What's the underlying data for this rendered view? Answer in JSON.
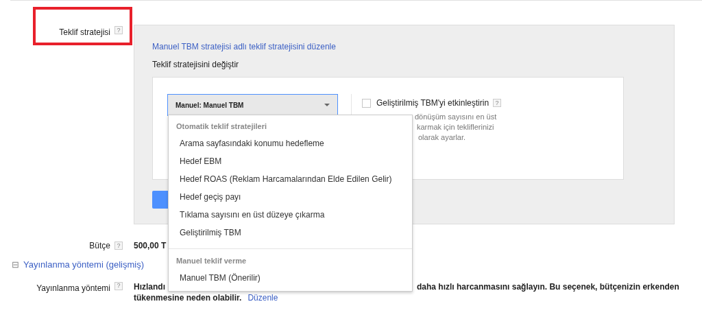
{
  "bid_strategy": {
    "label": "Teklif stratejisi",
    "help": "?",
    "highlighted": true,
    "edit_link": "Manuel TBM stratejisi adlı teklif stratejisini düzenle",
    "change_heading": "Teklif stratejisini değiştir",
    "dropdown": {
      "value": "Manuel: Manuel TBM",
      "expanded": true
    },
    "enhanced_cpc": {
      "label": "Geliştirilmiş TBM'yi etkinleştirin",
      "help": "?",
      "checked": false,
      "description_lines": [
        "dönüşüm sayısını en üst",
        "karmak için tekliflerinizi",
        "olarak ayarlar."
      ]
    }
  },
  "menu": {
    "groups": [
      {
        "header": "Otomatik teklif stratejileri",
        "items": [
          "Arama sayfasındaki konumu hedefleme",
          "Hedef EBM",
          "Hedef ROAS (Reklam Harcamalarından Elde Edilen Gelir)",
          "Hedef geçiş payı",
          "Tıklama sayısını en üst düzeye çıkarma",
          "Geliştirilmiş TBM"
        ]
      },
      {
        "header": "Manuel teklif verme",
        "items": [
          "Manuel TBM (Önerilir)"
        ]
      }
    ]
  },
  "budget": {
    "label": "Bütçe",
    "help": "?",
    "value": "500,00 T"
  },
  "delivery_section": {
    "toggle": "⊟",
    "title": "Yayınlanma yöntemi (gelişmiş)",
    "expanded": true
  },
  "delivery": {
    "label": "Yayınlanma yöntemi",
    "help": "?",
    "value_start": "Hızlandı",
    "value_rest": "daha hızlı harcanmasını sağlayın. Bu seçenek, bütçenizin erkenden",
    "value_line2": "tükenmesine neden olabilir.",
    "edit_link": "Düzenle"
  }
}
